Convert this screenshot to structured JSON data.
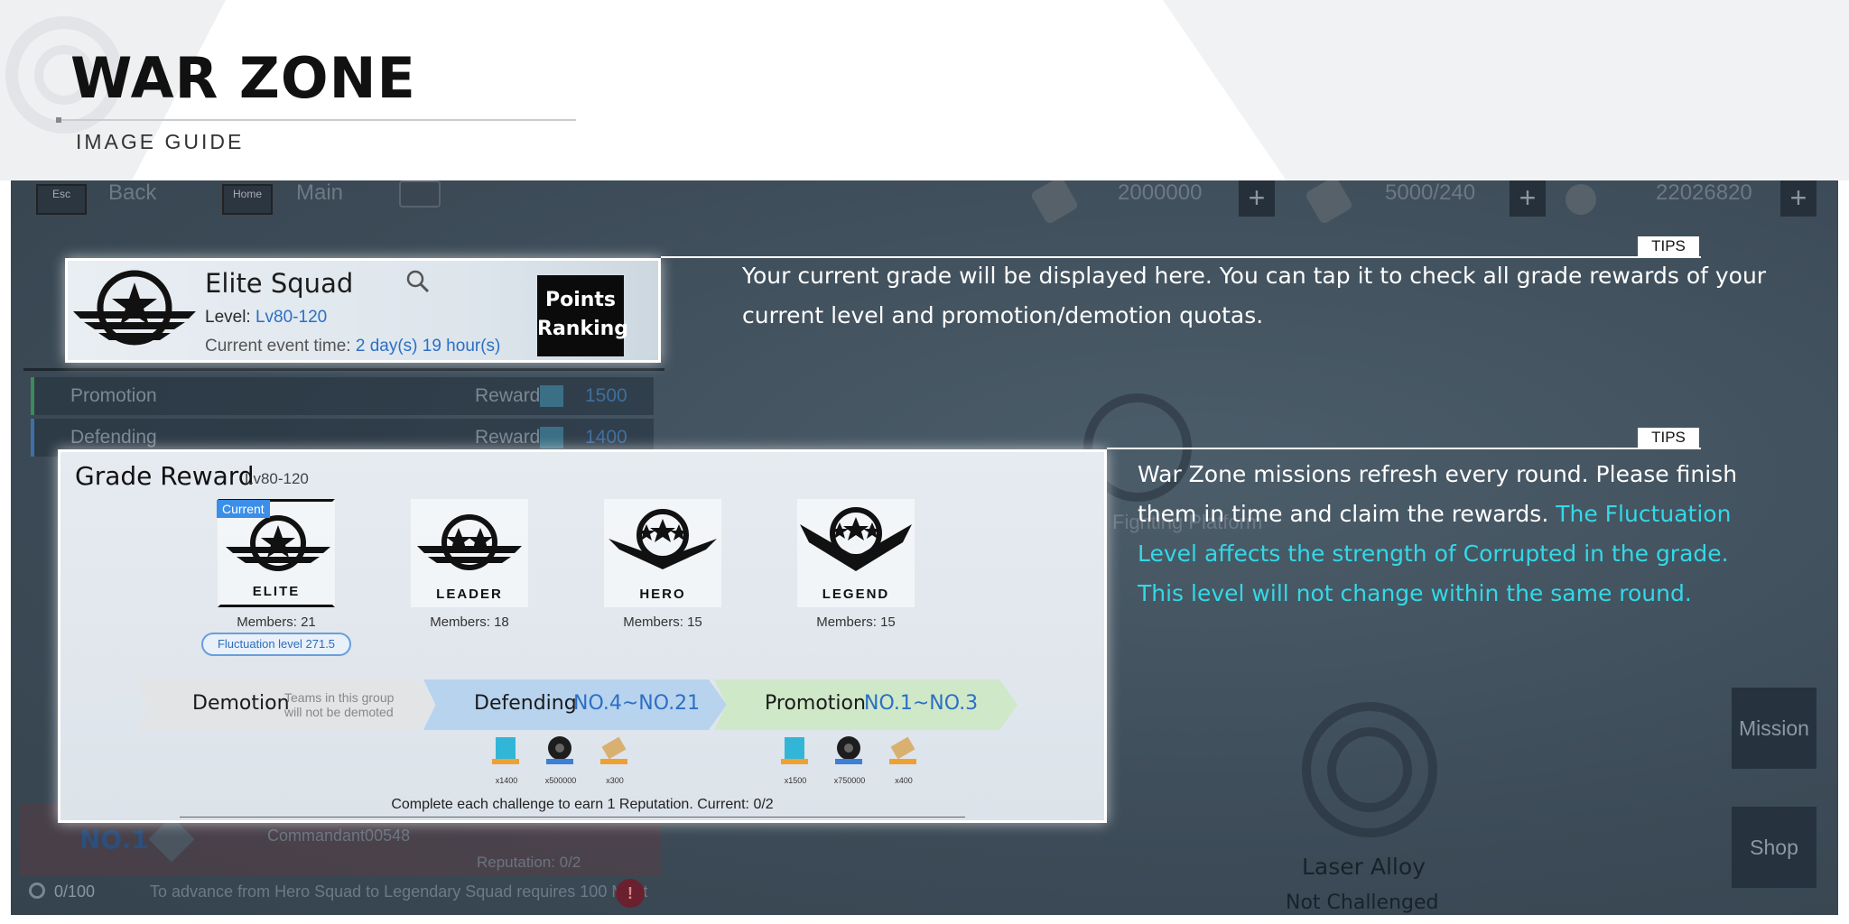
{
  "header": {
    "title": "WAR ZONE",
    "subtitle": "IMAGE GUIDE"
  },
  "topbar": {
    "esc_key": "Esc",
    "back_label": "Back",
    "home_key": "Home",
    "main_label": "Main",
    "resources": [
      {
        "icon": "fuel-icon",
        "value": "2000000"
      },
      {
        "icon": "alloy-icon",
        "value": "5000/240"
      },
      {
        "icon": "coin-icon",
        "value": "22026820"
      }
    ]
  },
  "squad_card": {
    "name": "Elite Squad",
    "level_label": "Level:",
    "level_value": "Lv80-120",
    "time_label": "Current event time:",
    "time_value": "2 day(s) 19 hour(s)",
    "points_ranking": "Points Ranking"
  },
  "background_rows": {
    "promotion": {
      "label": "Promotion",
      "reward_label": "Reward",
      "value": "1500"
    },
    "defending": {
      "label": "Defending",
      "reward_label": "Reward",
      "value": "1400"
    },
    "rank": {
      "no": "NO.1",
      "name": "Commandant00548",
      "reputation": "Reputation: 0/2"
    },
    "merit": {
      "value": "0/100",
      "text": "To advance from Hero Squad to Legendary Squad requires 100 Merit"
    },
    "laser": {
      "title": "Laser Alloy",
      "status": "Not Challenged"
    },
    "fight_label": "Fighting Platform"
  },
  "side_buttons": {
    "mission": "Mission",
    "shop": "Shop"
  },
  "grade_reward": {
    "title": "Grade Reward",
    "level": "Lv80-120",
    "current_tag": "Current",
    "tiers": [
      {
        "name": "ELITE",
        "members": "Members: 21"
      },
      {
        "name": "LEADER",
        "members": "Members: 18"
      },
      {
        "name": "HERO",
        "members": "Members: 15"
      },
      {
        "name": "LEGEND",
        "members": "Members: 15"
      }
    ],
    "fluctuation": "Fluctuation level 271.5",
    "demotion_label": "Demotion",
    "demotion_note_1": "Teams in this group",
    "demotion_note_2": "will not be demoted",
    "defending_label": "Defending",
    "defending_range": "NO.4~NO.21",
    "promotion_label": "Promotion",
    "promotion_range": "NO.1~NO.3",
    "defending_items": [
      "x1400",
      "x500000",
      "x300"
    ],
    "promotion_items": [
      "x1500",
      "x750000",
      "x400"
    ],
    "complete_text": "Complete each challenge to earn 1 Reputation. Current: 0/2"
  },
  "tips": [
    {
      "tag": "TIPS",
      "line1": "Your current grade will be displayed here. You can tap it to check all grade rewards of your",
      "line2": "current level and promotion/demotion quotas."
    },
    {
      "tag": "TIPS",
      "line1": "War Zone missions refresh every round. Please finish",
      "line2a": "them in time and claim the rewards. ",
      "line2b": "The Fluctuation",
      "line3": "Level affects the strength of Corrupted in the grade.",
      "line4": "This level will not change within the same round."
    }
  ],
  "colors": {
    "accent_blue": "#2c6fc4",
    "tips_cyan": "#34d8e6",
    "game_bg": "#3f4f5c"
  }
}
